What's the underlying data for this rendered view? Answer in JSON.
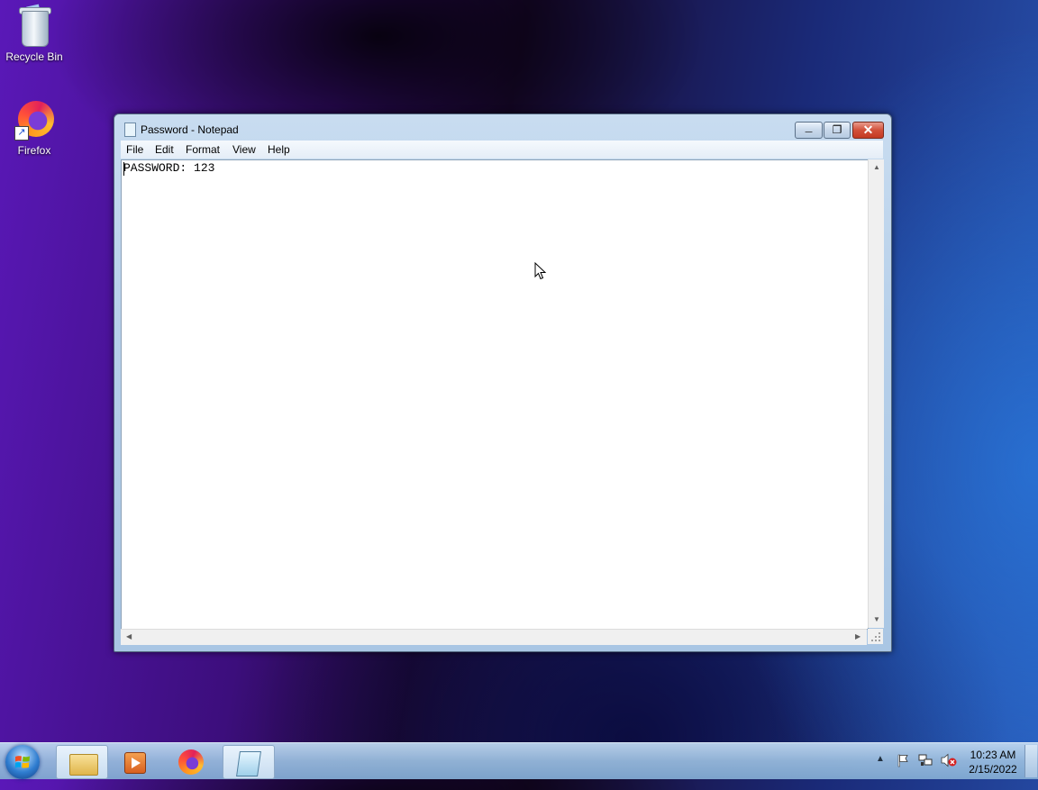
{
  "desktop": {
    "icons": [
      {
        "label": "Recycle Bin",
        "icon": "recycle-bin-icon"
      },
      {
        "label": "Firefox",
        "icon": "firefox-icon"
      }
    ]
  },
  "window": {
    "title": "Password - Notepad",
    "menu": [
      "File",
      "Edit",
      "Format",
      "View",
      "Help"
    ],
    "content": "PASSWORD: 123",
    "controls": {
      "minimize": "minimize-icon",
      "maximize": "maximize-icon",
      "close": "close-icon"
    }
  },
  "taskbar": {
    "pinned": [
      "file-explorer-icon",
      "media-player-icon",
      "firefox-icon",
      "notepad-icon"
    ],
    "active": "notepad-icon",
    "clock": {
      "time": "10:23 AM",
      "date": "2/15/2022"
    }
  },
  "colors": {
    "close_button": "#c43a22",
    "start_orb": "#2f7dd0"
  }
}
